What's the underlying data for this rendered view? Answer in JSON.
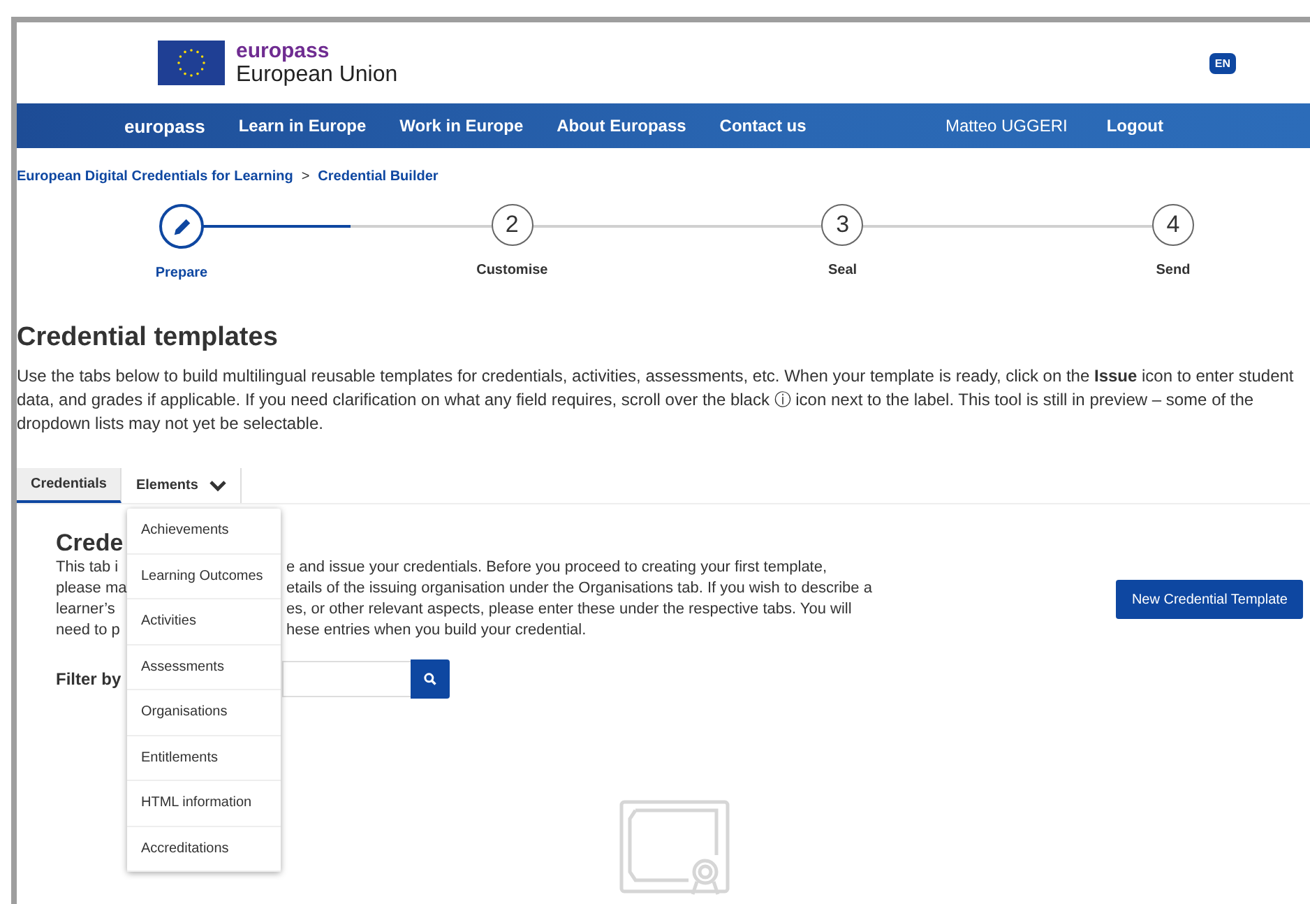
{
  "header": {
    "brand": "europass",
    "subtitle": "European Union",
    "language": "EN"
  },
  "nav": {
    "items": [
      "europass",
      "Learn in Europe",
      "Work in Europe",
      "About Europass",
      "Contact us"
    ],
    "user": "Matteo UGGERI",
    "logout": "Logout"
  },
  "breadcrumb": {
    "items": [
      "European Digital Credentials for Learning",
      "Credential Builder"
    ],
    "separator": ">"
  },
  "stepper": {
    "level": 0.17,
    "steps": [
      {
        "kind": "current",
        "label": "Prepare",
        "selected": true
      },
      {
        "kind": "pending",
        "number": "2",
        "label": "Customise",
        "selected": false
      },
      {
        "kind": "pending",
        "number": "3",
        "label": "Seal",
        "selected": false
      },
      {
        "kind": "pending",
        "number": "4",
        "label": "Send",
        "selected": false
      }
    ]
  },
  "page": {
    "title": "Credential templates",
    "intro": "Use the tabs below to build multilingual reusable templates for credentials, activities, assessments, etc. When your template is ready, click on the **Issue** icon to enter student data, and grades if applicable. If you need clarification on what any field requires, scroll over the black ⓘ icon next to the label. This tool is still in preview – some of the dropdown lists may not yet be selectable."
  },
  "tabs": [
    {
      "label": "Credentials",
      "selected": true,
      "kind": "plain"
    },
    {
      "label": "Elements",
      "selected": false,
      "kind": "dropdown",
      "expanded": true
    }
  ],
  "dropdown": {
    "items": [
      "Achievements",
      "Learning Outcomes",
      "Activities",
      "Assessments",
      "Organisations",
      "Entitlements",
      "HTML information",
      "Accreditations"
    ]
  },
  "card": {
    "title": "Crede",
    "lines": [
      {
        "left": "This tab i",
        "right": "e and issue your credentials. Before you proceed to creating your first template,"
      },
      {
        "left": "please ma",
        "right": "etails of the issuing organisation under the Organisations tab. If you wish to describe a"
      },
      {
        "left": "learner’s",
        "right": "es, or other relevant aspects, please enter these under the respective tabs. You will"
      },
      {
        "left": "need to p",
        "right": "hese entries when you build your credential."
      }
    ],
    "new_button": "New Credential Template",
    "filter_label": "Filter by"
  }
}
